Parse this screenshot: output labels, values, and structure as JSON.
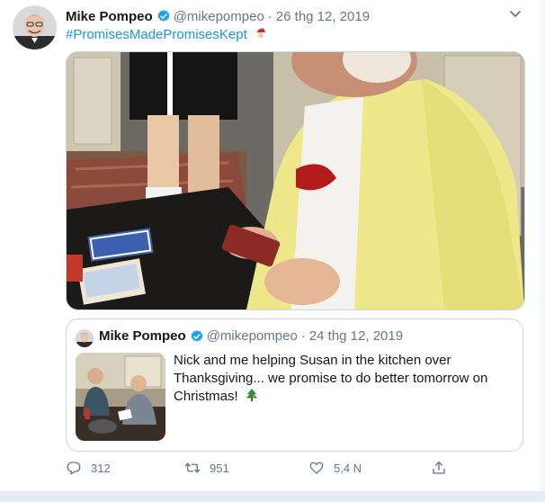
{
  "tweet": {
    "author_name": "Mike Pompeo",
    "handle": "@mikepompeo",
    "separator": "·",
    "date": "26 thg 12, 2019",
    "hashtag": "#PromisesMadePromisesKept",
    "icons": {
      "avatar": "profile-photo",
      "verified": "verified-badge-icon",
      "caret": "chevron-down-icon",
      "emoji": "santa-emoji"
    }
  },
  "quote": {
    "author_name": "Mike Pompeo",
    "handle": "@mikepompeo",
    "separator": "·",
    "date": "24 thg 12, 2019",
    "text": "Nick and me helping Susan in the kitchen over Thanksgiving... we promise to do better tomorrow on Christmas!",
    "emoji": "christmas-tree-emoji"
  },
  "actions": {
    "reply_count": "312",
    "retweet_count": "951",
    "like_count": "5,4 N",
    "icons": [
      "reply-icon",
      "retweet-icon",
      "like-icon",
      "share-icon"
    ]
  },
  "colors": {
    "accent": "#1b95e0",
    "muted": "#657786",
    "border": "#ccd6dd",
    "verified": "#1da1f2",
    "cardigan_yellow": "#efe88a"
  }
}
